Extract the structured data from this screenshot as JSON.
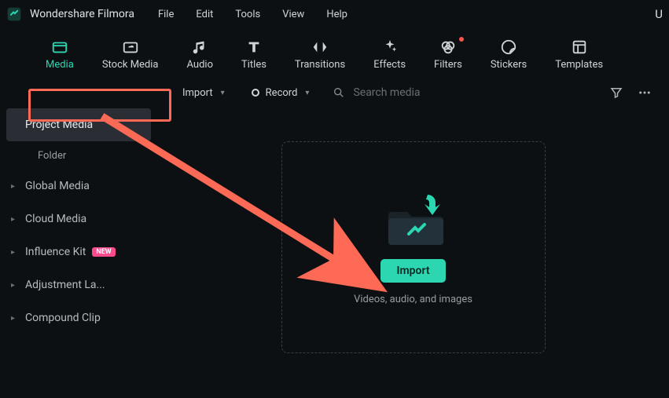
{
  "app": {
    "name": "Wondershare Filmora",
    "right_indicator": "U"
  },
  "menu": [
    "File",
    "Edit",
    "Tools",
    "View",
    "Help"
  ],
  "ribbon": [
    {
      "label": "Media",
      "icon": "media",
      "active": true
    },
    {
      "label": "Stock Media",
      "icon": "cloud"
    },
    {
      "label": "Audio",
      "icon": "music"
    },
    {
      "label": "Titles",
      "icon": "text"
    },
    {
      "label": "Transitions",
      "icon": "transition"
    },
    {
      "label": "Effects",
      "icon": "sparkle"
    },
    {
      "label": "Filters",
      "icon": "filter",
      "dot": true
    },
    {
      "label": "Stickers",
      "icon": "sticker"
    },
    {
      "label": "Templates",
      "icon": "template"
    }
  ],
  "toolbar": {
    "import_label": "Import",
    "record_label": "Record",
    "search_placeholder": "Search media"
  },
  "sidebar": {
    "items": [
      {
        "label": "Project Media",
        "active": true
      },
      {
        "label": "Folder",
        "sub": true
      },
      {
        "label": "Global Media",
        "chev": true
      },
      {
        "label": "Cloud Media",
        "chev": true
      },
      {
        "label": "Influence Kit",
        "chev": true,
        "badge": "NEW"
      },
      {
        "label": "Adjustment La...",
        "chev": true
      },
      {
        "label": "Compound Clip",
        "chev": true
      }
    ]
  },
  "drop": {
    "button": "Import",
    "desc": "Videos, audio, and images"
  },
  "colors": {
    "accent": "#2bd6b1",
    "annotation": "#ff6a56"
  }
}
